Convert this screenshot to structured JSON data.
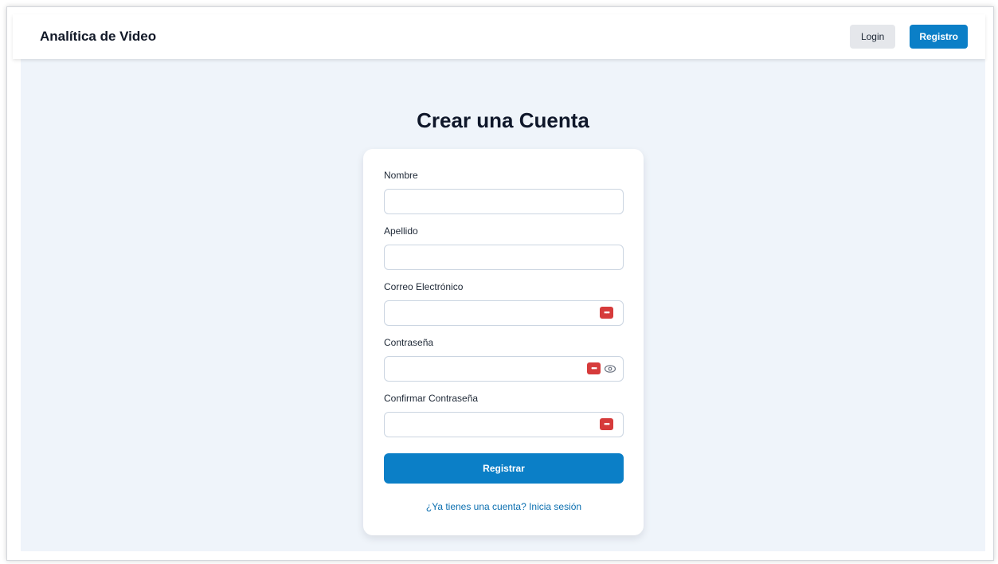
{
  "navbar": {
    "brand": "Analítica de Video",
    "login_label": "Login",
    "register_label": "Registro"
  },
  "page": {
    "title": "Crear una Cuenta"
  },
  "form": {
    "fields": [
      {
        "label": "Nombre",
        "value": "",
        "icon": null
      },
      {
        "label": "Apellido",
        "value": "",
        "icon": null
      },
      {
        "label": "Correo Electrónico",
        "value": "",
        "icon": "password-manager-icon"
      },
      {
        "label": "Contraseña",
        "value": "",
        "icon": "password-manager-icon",
        "extra_icon": "eye-icon"
      },
      {
        "label": "Confirmar Contraseña",
        "value": "",
        "icon": "password-manager-icon"
      }
    ],
    "submit_label": "Registrar",
    "login_link": "¿Ya tienes una cuenta? Inicia sesión"
  },
  "colors": {
    "primary": "#0b7fc7",
    "background": "#eff4fa",
    "password_manager_badge": "#d63b3b"
  }
}
